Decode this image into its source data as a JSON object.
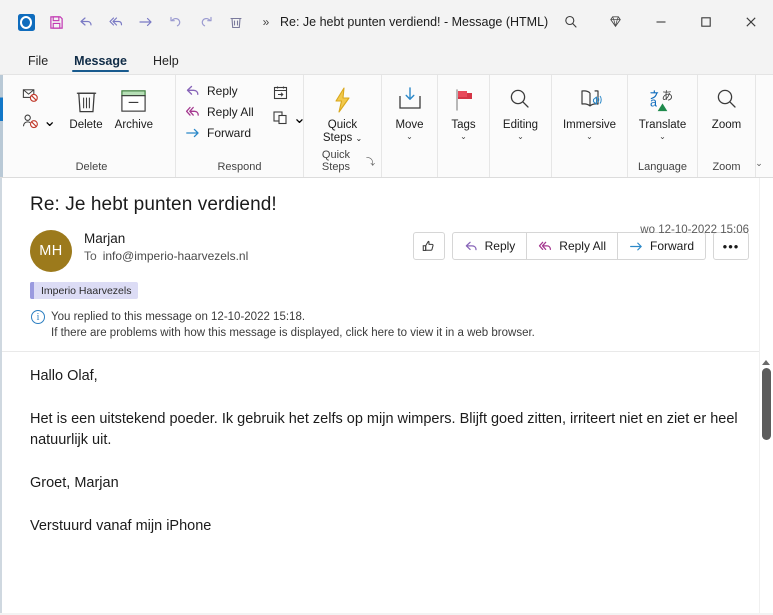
{
  "window": {
    "title": "Re: Je hebt punten verdiend!  -  Message (HTML)",
    "quick_access": [
      {
        "name": "outlook-icon",
        "label": "Outlook"
      },
      {
        "name": "save-icon",
        "label": "Save"
      },
      {
        "name": "reply-icon",
        "label": "Reply"
      },
      {
        "name": "reply-all-icon",
        "label": "Reply All"
      },
      {
        "name": "forward-icon",
        "label": "Forward"
      },
      {
        "name": "undo-icon",
        "label": "Undo"
      },
      {
        "name": "redo-icon",
        "label": "Redo"
      },
      {
        "name": "delete-icon",
        "label": "Delete"
      },
      {
        "name": "overflow-icon",
        "label": "»"
      }
    ],
    "controls": {
      "search": "Search",
      "gem": "Microsoft 365",
      "minimize": "─",
      "maximize": "☐",
      "close": "✕"
    }
  },
  "tabs": [
    {
      "label": "File",
      "active": false
    },
    {
      "label": "Message",
      "active": true
    },
    {
      "label": "Help",
      "active": false
    }
  ],
  "ribbon": {
    "groups": [
      {
        "name": "delete",
        "label": "Delete",
        "buttons": [
          {
            "label": "Ignore",
            "icon": "ignore-icon"
          },
          {
            "label": "Junk",
            "icon": "junk-icon",
            "chevron": "⌄"
          },
          {
            "label": "Delete",
            "icon": "trash-icon"
          },
          {
            "label": "Archive",
            "icon": "archive-icon"
          }
        ]
      },
      {
        "name": "respond",
        "label": "Respond",
        "buttons": [
          {
            "label": "Reply",
            "icon": "reply-icon"
          },
          {
            "label": "Reply All",
            "icon": "reply-all-icon"
          },
          {
            "label": "Forward",
            "icon": "forward-icon"
          },
          {
            "label": "Meeting",
            "icon": "meeting-icon"
          },
          {
            "label": "More",
            "icon": "more-respond-icon",
            "chevron": "⌄"
          }
        ]
      },
      {
        "name": "quick-steps",
        "label": "Quick Steps",
        "launcher": "⤵",
        "buttons": [
          {
            "label": "Quick\nSteps",
            "label_line1": "Quick",
            "label_line2": "Steps",
            "icon": "lightning-icon",
            "chevron": "⌄"
          }
        ]
      },
      {
        "name": "move",
        "label": "",
        "buttons": [
          {
            "label": "Move",
            "icon": "move-icon",
            "chevron": "⌄"
          }
        ]
      },
      {
        "name": "tags",
        "label": "",
        "buttons": [
          {
            "label": "Tags",
            "icon": "flag-icon",
            "chevron": "⌄"
          }
        ]
      },
      {
        "name": "editing",
        "label": "",
        "buttons": [
          {
            "label": "Editing",
            "icon": "magnifier-icon",
            "chevron": "⌄"
          }
        ]
      },
      {
        "name": "immersive",
        "label": "",
        "buttons": [
          {
            "label": "Immersive",
            "icon": "read-aloud-icon",
            "chevron": "⌄"
          }
        ]
      },
      {
        "name": "language",
        "label": "Language",
        "buttons": [
          {
            "label": "Translate",
            "icon": "translate-icon",
            "chevron": "⌄"
          }
        ]
      },
      {
        "name": "zoom",
        "label": "Zoom",
        "buttons": [
          {
            "label": "Zoom",
            "icon": "zoom-icon"
          }
        ]
      }
    ],
    "collapse": "⌄"
  },
  "message": {
    "subject": "Re: Je hebt punten verdiend!",
    "avatar_initials": "MH",
    "avatar_color": "#9c7a1c",
    "sender": "Marjan",
    "to_label": "To",
    "to_value": "info@imperio-haarvezels.nl",
    "date": "wo 12-10-2022 15:06",
    "category": "Imperio Haarvezels",
    "category_color": "#dcdcf5",
    "info_line1": "You replied to this message on 12-10-2022 15:18.",
    "info_line2": "If there are problems with how this message is displayed, click here to view it in a web browser.",
    "actions": [
      {
        "name": "thumbs-up-button",
        "label": "",
        "icon": "thumbs-up-icon"
      },
      {
        "name": "reply-button",
        "label": "Reply",
        "icon": "reply-icon"
      },
      {
        "name": "reply-all-button",
        "label": "Reply All",
        "icon": "reply-all-icon"
      },
      {
        "name": "forward-button",
        "label": "Forward",
        "icon": "forward-icon"
      },
      {
        "name": "more-actions-button",
        "label": "•••",
        "icon": "ellipsis-icon"
      }
    ],
    "body": [
      "Hallo Olaf,",
      "Het is een uitstekend poeder. Ik gebruik het zelfs op mijn wimpers. Blijft goed zitten, irriteert niet en ziet er heel natuurlijk uit.",
      "Groet, Marjan",
      "Verstuurd vanaf mijn iPhone"
    ]
  }
}
